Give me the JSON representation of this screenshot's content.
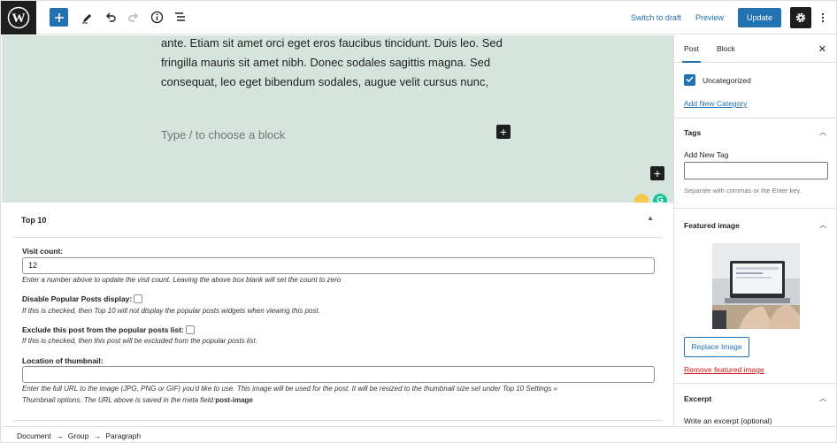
{
  "toolbar": {
    "switch_to_draft": "Switch to draft",
    "preview": "Preview",
    "update": "Update"
  },
  "editor": {
    "paragraph_lines": [
      "ante. Etiam sit amet orci eget eros faucibus tincidunt. Duis leo. Sed",
      "fringilla mauris sit amet nibh. Donec sodales sagittis magna. Sed",
      "consequat, leo eget bibendum sodales, augue velit cursus nunc,"
    ],
    "block_placeholder": "Type / to choose a block"
  },
  "metabox": {
    "title": "Top 10",
    "visit_count_label": "Visit count:",
    "visit_count_value": "12",
    "visit_count_help": "Enter a number above to update the visit count. Leaving the above box blank will set the count to zero",
    "disable_label": "Disable Popular Posts display:",
    "disable_help": "If this is checked, then Top 10 will not display the popular posts widgets when viewing this post.",
    "exclude_label": "Exclude this post from the popular posts list:",
    "exclude_help": "If this is checked, then this post will be excluded from the popular posts list.",
    "thumbnail_label": "Location of thumbnail:",
    "thumbnail_value": "",
    "thumbnail_help_line1": "Enter the full URL to the image (JPG, PNG or GIF) you'd like to use. This image will be used for the post. It will be resized to the thumbnail size set under Top 10 Settings »",
    "thumbnail_help_line2": "Thumbnail options. The URL above is saved in the meta field:",
    "thumbnail_help_field": "post-image"
  },
  "breadcrumb": {
    "items": [
      "Document",
      "Group",
      "Paragraph"
    ],
    "separator": "→"
  },
  "sidebar": {
    "tabs": [
      "Post",
      "Block"
    ],
    "active_tab": "Post",
    "close_glyph": "✕",
    "categories": {
      "item_label": "Uncategorized",
      "add_new_link": "Add New Category"
    },
    "tags": {
      "title": "Tags",
      "input_label": "Add New Tag",
      "input_value": "",
      "help": "Separate with commas or the Enter key."
    },
    "featured_image": {
      "title": "Featured image",
      "replace_button": "Replace Image",
      "remove_link": "Remove featured image"
    },
    "excerpt": {
      "title": "Excerpt",
      "label": "Write an excerpt (optional)"
    }
  },
  "colors": {
    "accent": "#2271b1",
    "canvas_bg": "#d5e5dd",
    "danger": "#cc1818",
    "logo_bg": "#1e1e1e"
  },
  "icons": {
    "logo": "wordpress-logo",
    "add": "plus-icon",
    "edit": "pencil-icon",
    "undo": "undo-icon",
    "redo": "redo-icon",
    "info": "info-icon",
    "outline": "list-view-icon",
    "settings": "gear-icon",
    "more": "more-vertical-icon"
  }
}
